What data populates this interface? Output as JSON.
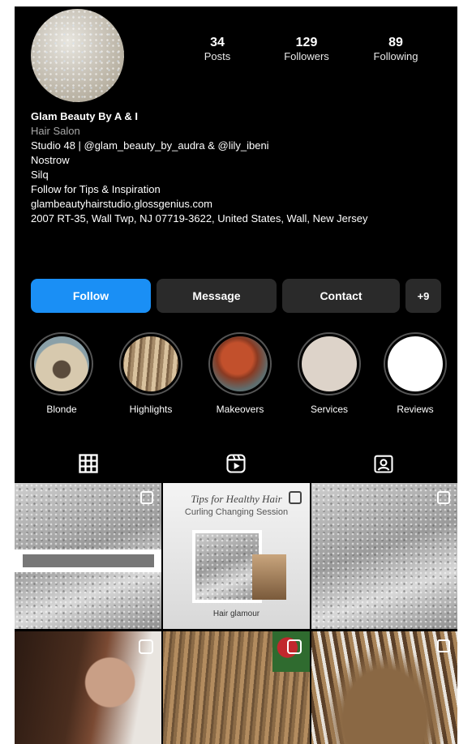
{
  "profile": {
    "stats": [
      {
        "value": "34",
        "label": "Posts"
      },
      {
        "value": "129",
        "label": "Followers"
      },
      {
        "value": "89",
        "label": "Following"
      }
    ],
    "name": "Glam Beauty By A & I",
    "category": "Hair Salon",
    "bio_line1": "Studio 48 | @glam_beauty_by_audra & @lily_ibeni",
    "bio_line2": "Nostrow",
    "bio_line3": "Silq",
    "bio_line4": "Follow for Tips & Inspiration",
    "website": "glambeautyhairstudio.glossgenius.com",
    "address": "2007 RT-35, Wall Twp, NJ 07719-3622, United States, Wall, New Jersey"
  },
  "buttons": {
    "follow": "Follow",
    "message": "Message",
    "contact": "Contact",
    "add_user": "+9"
  },
  "highlights": [
    {
      "label": "Blonde"
    },
    {
      "label": "Highlights"
    },
    {
      "label": "Makeovers"
    },
    {
      "label": "Services"
    },
    {
      "label": "Reviews"
    }
  ],
  "post2": {
    "title": "Tips for Healthy Hair",
    "subtitle": "Curling Changing Session",
    "signature": "Hair glamour"
  },
  "colors": {
    "background": "#000000",
    "follow_button": "#1a8ff5",
    "secondary_button": "#2a2a2a"
  },
  "tabs": [
    "grid-icon",
    "reels-icon",
    "tagged-icon"
  ]
}
